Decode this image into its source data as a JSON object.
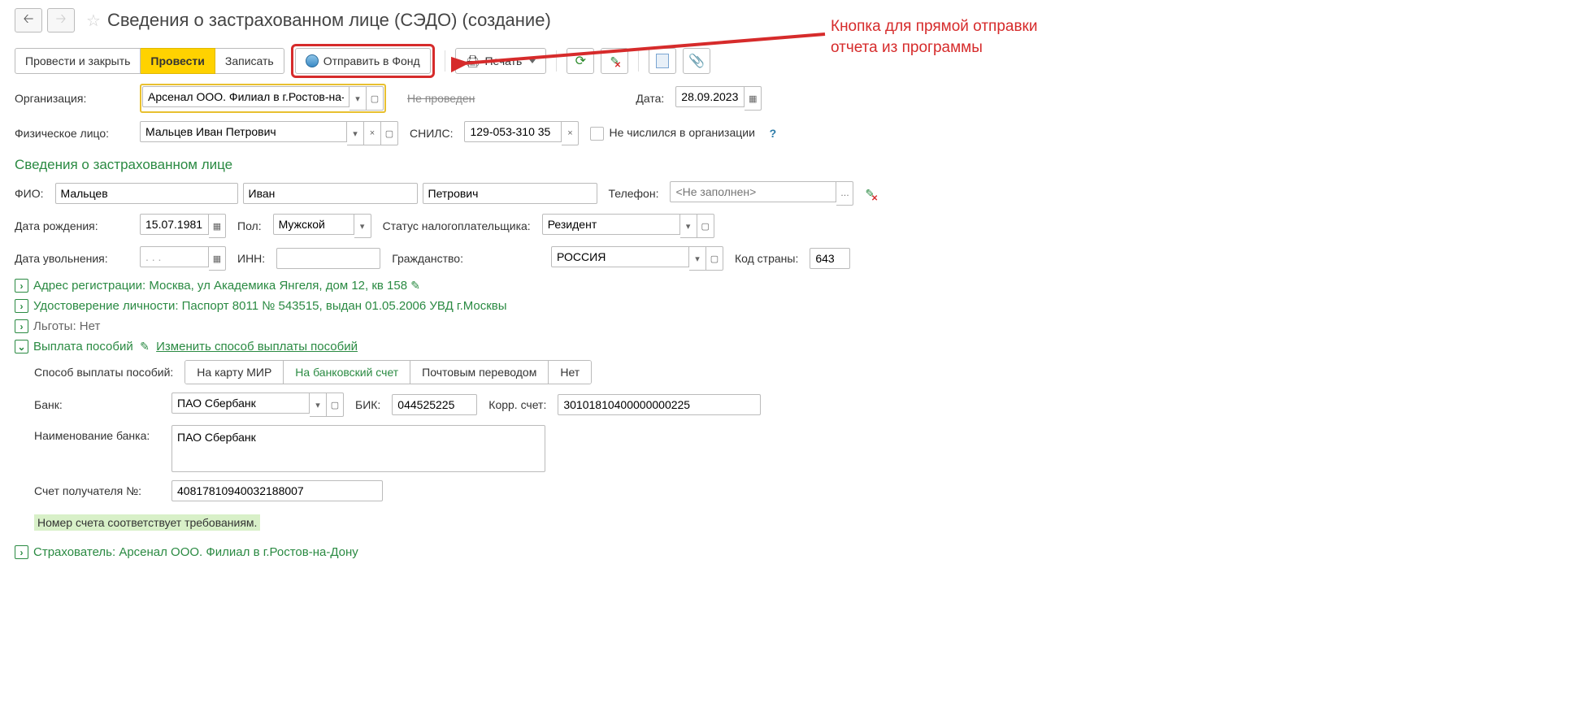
{
  "title": "Сведения о застрахованном лице (СЭДО) (создание)",
  "toolbar": {
    "post_close": "Провести и закрыть",
    "post": "Провести",
    "write": "Записать",
    "send": "Отправить в Фонд",
    "print": "Печать"
  },
  "org": {
    "label": "Организация:",
    "value": "Арсенал ООО. Филиал в г.Ростов-на-Дону",
    "status": "Не проведен"
  },
  "date": {
    "label": "Дата:",
    "value": "28.09.2023"
  },
  "person": {
    "label": "Физическое лицо:",
    "value": "Мальцев Иван Петрович"
  },
  "snils": {
    "label": "СНИЛС:",
    "value": "129-053-310 35"
  },
  "not_listed": "Не числился в организации",
  "section_insured": "Сведения о застрахованном лице",
  "fio": {
    "label": "ФИО:",
    "last": "Мальцев",
    "first": "Иван",
    "middle": "Петрович"
  },
  "phone": {
    "label": "Телефон:",
    "placeholder": "<Не заполнен>"
  },
  "birth": {
    "label": "Дата рождения:",
    "value": "15.07.1981"
  },
  "sex": {
    "label": "Пол:",
    "value": "Мужской"
  },
  "tax": {
    "label": "Статус налогоплательщика:",
    "value": "Резидент"
  },
  "fire": {
    "label": "Дата увольнения:",
    "value": ". . ."
  },
  "inn": {
    "label": "ИНН:",
    "value": ""
  },
  "citizen": {
    "label": "Гражданство:",
    "value": "РОССИЯ"
  },
  "country": {
    "label": "Код страны:",
    "value": "643"
  },
  "address": "Адрес регистрации: Москва, ул Академика Янгеля, дом 12, кв 158",
  "iddoc": "Удостоверение личности: Паспорт 8011 № 543515, выдан 01.05.2006 УВД г.Москвы",
  "benefits": "Льготы: Нет",
  "payout": {
    "header": "Выплата пособий",
    "change": "Изменить способ выплаты пособий",
    "method_label": "Способ выплаты пособий:",
    "opt_mir": "На карту МИР",
    "opt_bank": "На банковский счет",
    "opt_post": "Почтовым переводом",
    "opt_no": "Нет"
  },
  "bank": {
    "label": "Банк:",
    "value": "ПАО Сбербанк"
  },
  "bik": {
    "label": "БИК:",
    "value": "044525225"
  },
  "korr": {
    "label": "Корр. счет:",
    "value": "30101810400000000225"
  },
  "bankname": {
    "label": "Наименование банка:",
    "value": "ПАО Сбербанк"
  },
  "acct": {
    "label": "Счет получателя №:",
    "value": "40817810940032188007"
  },
  "acct_ok": "Номер счета соответствует требованиям.",
  "insurer": "Страхователь: Арсенал ООО. Филиал в г.Ростов-на-Дону",
  "annotation": {
    "l1": "Кнопка для прямой отправки",
    "l2": "отчета из программы"
  }
}
